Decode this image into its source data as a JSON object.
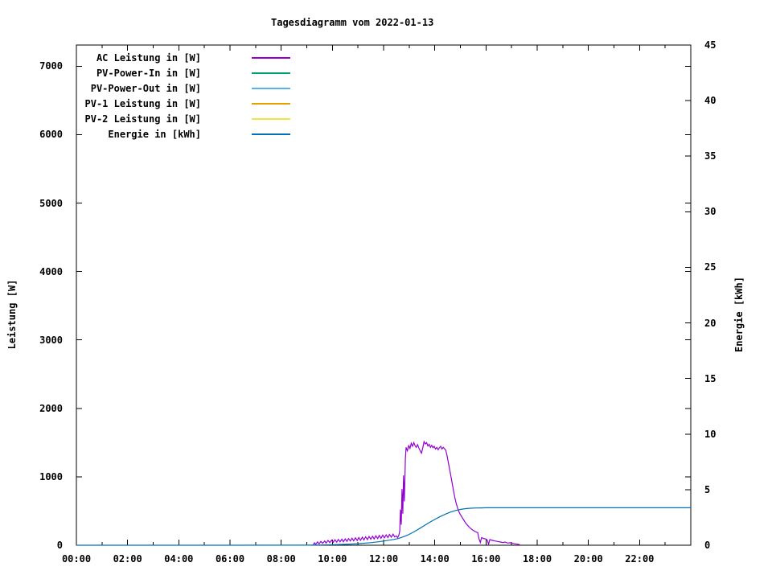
{
  "chart_data": {
    "type": "line",
    "title": "Tagesdiagramm vom 2022-01-13",
    "x_axis": {
      "ticks": [
        "00:00",
        "02:00",
        "04:00",
        "06:00",
        "08:00",
        "10:00",
        "12:00",
        "14:00",
        "16:00",
        "18:00",
        "20:00",
        "22:00"
      ],
      "range_hours": [
        0,
        24
      ],
      "major_tick_hours": 2,
      "minor_tick_hours": 1
    },
    "y_left": {
      "label": "Leistung [W]",
      "ticks": [
        "0",
        "1000",
        "2000",
        "3000",
        "4000",
        "5000",
        "6000",
        "7000"
      ],
      "range": [
        0,
        7310
      ]
    },
    "y_right": {
      "label": "Energie [kWh]",
      "ticks": [
        "0",
        "5",
        "10",
        "15",
        "20",
        "25",
        "30",
        "35",
        "40",
        "45"
      ],
      "range": [
        0,
        45
      ]
    },
    "grid": false,
    "legend_position": "top-left-inside",
    "legend": [
      {
        "label": "AC Leistung in [W]",
        "color": "#9400d3"
      },
      {
        "label": "PV-Power-In in [W]",
        "color": "#009e73"
      },
      {
        "label": "PV-Power-Out in [W]",
        "color": "#56b4e9"
      },
      {
        "label": "PV-1 Leistung in [W]",
        "color": "#e69f00"
      },
      {
        "label": "PV-2 Leistung in [W]",
        "color": "#f0e442"
      },
      {
        "label": "Energie in [kWh]",
        "color": "#0072b2"
      }
    ],
    "series": [
      {
        "name": "AC Leistung in [W]",
        "axis": "left",
        "color": "#9400d3",
        "units": "W",
        "points": [
          [
            9.25,
            5
          ],
          [
            9.3,
            35
          ],
          [
            9.35,
            12
          ],
          [
            9.42,
            48
          ],
          [
            9.48,
            20
          ],
          [
            9.55,
            55
          ],
          [
            9.62,
            28
          ],
          [
            9.7,
            62
          ],
          [
            9.75,
            32
          ],
          [
            9.83,
            70
          ],
          [
            9.9,
            38
          ],
          [
            9.97,
            75
          ],
          [
            10.03,
            42
          ],
          [
            10.1,
            80
          ],
          [
            10.17,
            45
          ],
          [
            10.23,
            85
          ],
          [
            10.3,
            50
          ],
          [
            10.37,
            88
          ],
          [
            10.43,
            52
          ],
          [
            10.5,
            92
          ],
          [
            10.57,
            58
          ],
          [
            10.63,
            98
          ],
          [
            10.7,
            62
          ],
          [
            10.77,
            102
          ],
          [
            10.83,
            65
          ],
          [
            10.9,
            108
          ],
          [
            10.97,
            68
          ],
          [
            11.03,
            112
          ],
          [
            11.1,
            72
          ],
          [
            11.17,
            118
          ],
          [
            11.23,
            78
          ],
          [
            11.3,
            122
          ],
          [
            11.37,
            82
          ],
          [
            11.43,
            128
          ],
          [
            11.5,
            88
          ],
          [
            11.57,
            132
          ],
          [
            11.63,
            92
          ],
          [
            11.7,
            138
          ],
          [
            11.77,
            96
          ],
          [
            11.83,
            142
          ],
          [
            11.9,
            102
          ],
          [
            11.97,
            148
          ],
          [
            12.03,
            108
          ],
          [
            12.1,
            152
          ],
          [
            12.17,
            112
          ],
          [
            12.23,
            158
          ],
          [
            12.3,
            118
          ],
          [
            12.37,
            162
          ],
          [
            12.43,
            122
          ],
          [
            12.5,
            135
          ],
          [
            12.55,
            110
          ],
          [
            12.6,
            150
          ],
          [
            12.63,
            210
          ],
          [
            12.66,
            520
          ],
          [
            12.69,
            300
          ],
          [
            12.72,
            820
          ],
          [
            12.75,
            460
          ],
          [
            12.78,
            1020
          ],
          [
            12.81,
            640
          ],
          [
            12.85,
            1260
          ],
          [
            12.88,
            1430
          ],
          [
            12.93,
            1380
          ],
          [
            12.98,
            1455
          ],
          [
            13.03,
            1415
          ],
          [
            13.08,
            1490
          ],
          [
            13.13,
            1445
          ],
          [
            13.18,
            1500
          ],
          [
            13.23,
            1455
          ],
          [
            13.28,
            1430
          ],
          [
            13.33,
            1470
          ],
          [
            13.38,
            1420
          ],
          [
            13.43,
            1380
          ],
          [
            13.48,
            1345
          ],
          [
            13.53,
            1420
          ],
          [
            13.58,
            1515
          ],
          [
            13.63,
            1480
          ],
          [
            13.68,
            1500
          ],
          [
            13.73,
            1450
          ],
          [
            13.78,
            1475
          ],
          [
            13.83,
            1430
          ],
          [
            13.88,
            1460
          ],
          [
            13.93,
            1425
          ],
          [
            13.98,
            1445
          ],
          [
            14.03,
            1405
          ],
          [
            14.08,
            1430
          ],
          [
            14.13,
            1395
          ],
          [
            14.18,
            1425
          ],
          [
            14.23,
            1445
          ],
          [
            14.28,
            1405
          ],
          [
            14.33,
            1430
          ],
          [
            14.38,
            1410
          ],
          [
            14.43,
            1385
          ],
          [
            14.48,
            1310
          ],
          [
            14.53,
            1210
          ],
          [
            14.58,
            1110
          ],
          [
            14.63,
            1010
          ],
          [
            14.68,
            905
          ],
          [
            14.73,
            800
          ],
          [
            14.78,
            700
          ],
          [
            14.83,
            620
          ],
          [
            14.88,
            555
          ],
          [
            14.93,
            500
          ],
          [
            14.98,
            460
          ],
          [
            15.03,
            430
          ],
          [
            15.08,
            400
          ],
          [
            15.13,
            370
          ],
          [
            15.18,
            340
          ],
          [
            15.23,
            312
          ],
          [
            15.28,
            292
          ],
          [
            15.33,
            272
          ],
          [
            15.38,
            252
          ],
          [
            15.48,
            222
          ],
          [
            15.58,
            200
          ],
          [
            15.68,
            182
          ],
          [
            15.73,
            92
          ],
          [
            15.78,
            40
          ],
          [
            15.83,
            112
          ],
          [
            15.9,
            100
          ],
          [
            16.0,
            90
          ],
          [
            16.05,
            78
          ],
          [
            16.1,
            12
          ],
          [
            16.15,
            82
          ],
          [
            16.25,
            70
          ],
          [
            16.35,
            62
          ],
          [
            16.45,
            55
          ],
          [
            16.55,
            48
          ],
          [
            16.65,
            40
          ],
          [
            16.75,
            46
          ],
          [
            16.85,
            32
          ],
          [
            16.95,
            36
          ],
          [
            17.05,
            26
          ],
          [
            17.15,
            20
          ],
          [
            17.25,
            14
          ],
          [
            17.32,
            8
          ]
        ]
      },
      {
        "name": "PV-Power-In in [W]",
        "axis": "left",
        "color": "#009e73",
        "units": "W",
        "points": []
      },
      {
        "name": "PV-Power-Out in [W]",
        "axis": "left",
        "color": "#56b4e9",
        "units": "W",
        "points": []
      },
      {
        "name": "PV-1 Leistung in [W]",
        "axis": "left",
        "color": "#e69f00",
        "units": "W",
        "points": []
      },
      {
        "name": "PV-2 Leistung in [W]",
        "axis": "left",
        "color": "#f0e442",
        "units": "W",
        "points": []
      },
      {
        "name": "Energie in [kWh]",
        "axis": "right",
        "color": "#0072b2",
        "units": "kWh",
        "points": [
          [
            0,
            0
          ],
          [
            6,
            0
          ],
          [
            9,
            0.01
          ],
          [
            9.5,
            0.02
          ],
          [
            10,
            0.04
          ],
          [
            10.5,
            0.08
          ],
          [
            11,
            0.14
          ],
          [
            11.5,
            0.23
          ],
          [
            11.8,
            0.31
          ],
          [
            12.1,
            0.41
          ],
          [
            12.4,
            0.52
          ],
          [
            12.6,
            0.62
          ],
          [
            12.8,
            0.78
          ],
          [
            13.0,
            0.98
          ],
          [
            13.2,
            1.22
          ],
          [
            13.4,
            1.5
          ],
          [
            13.6,
            1.78
          ],
          [
            13.8,
            2.06
          ],
          [
            14.0,
            2.32
          ],
          [
            14.2,
            2.56
          ],
          [
            14.4,
            2.78
          ],
          [
            14.6,
            2.97
          ],
          [
            14.8,
            3.12
          ],
          [
            15.0,
            3.22
          ],
          [
            15.2,
            3.29
          ],
          [
            15.4,
            3.33
          ],
          [
            15.6,
            3.35
          ],
          [
            15.8,
            3.36
          ],
          [
            16.0,
            3.37
          ],
          [
            16.5,
            3.37
          ],
          [
            17.0,
            3.37
          ],
          [
            24,
            3.37
          ]
        ]
      }
    ]
  }
}
